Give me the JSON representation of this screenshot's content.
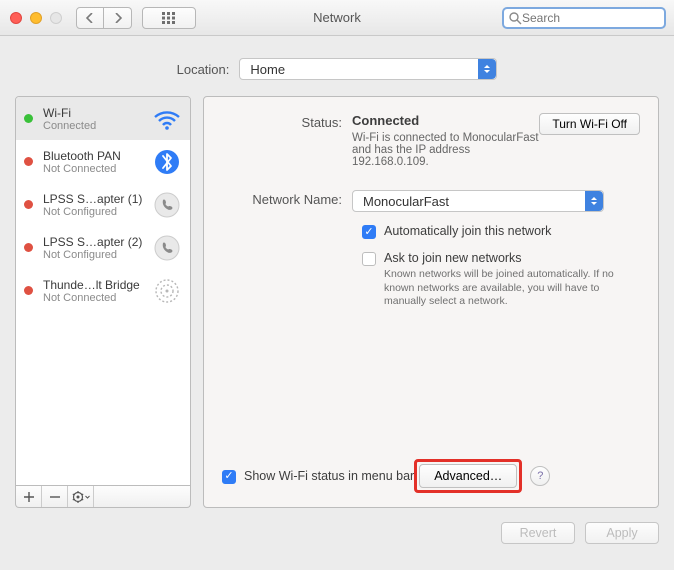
{
  "window": {
    "title": "Network"
  },
  "search": {
    "placeholder": "Search"
  },
  "location": {
    "label": "Location:",
    "value": "Home"
  },
  "sidebar": {
    "items": [
      {
        "name": "Wi-Fi",
        "status": "Connected",
        "dot": "green",
        "icon": "wifi"
      },
      {
        "name": "Bluetooth PAN",
        "status": "Not Connected",
        "dot": "red",
        "icon": "bluetooth"
      },
      {
        "name": "LPSS S…apter (1)",
        "status": "Not Configured",
        "dot": "red",
        "icon": "phone"
      },
      {
        "name": "LPSS S…apter (2)",
        "status": "Not Configured",
        "dot": "red",
        "icon": "phone"
      },
      {
        "name": "Thunde…lt Bridge",
        "status": "Not Connected",
        "dot": "red",
        "icon": "thunderbolt"
      }
    ]
  },
  "detail": {
    "status_label": "Status:",
    "status_value": "Connected",
    "off_button": "Turn Wi-Fi Off",
    "status_desc": "Wi-Fi is connected to MonocularFast and has the IP address 192.168.0.109.",
    "network_label": "Network Name:",
    "network_value": "MonocularFast",
    "auto_join": "Automatically join this network",
    "ask_join": "Ask to join new networks",
    "ask_join_desc": "Known networks will be joined automatically. If no known networks are available, you will have to manually select a network.",
    "show_menu": "Show Wi-Fi status in menu bar",
    "advanced": "Advanced…"
  },
  "footer": {
    "revert": "Revert",
    "apply": "Apply"
  }
}
